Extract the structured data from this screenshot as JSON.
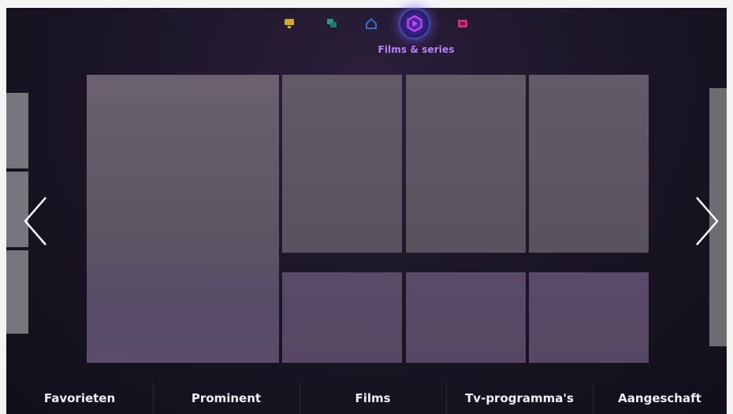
{
  "hub": {
    "title": "Films & series",
    "icons": [
      {
        "name": "on-tv-icon",
        "color": "#d4a72b"
      },
      {
        "name": "social-icon",
        "color": "#2a9c86"
      },
      {
        "name": "apps-icon",
        "color": "#2f6fd0"
      },
      {
        "name": "films-series-icon",
        "color": "#c63bd1",
        "active": true
      },
      {
        "name": "multimedia-icon",
        "color": "#d02f6d"
      }
    ]
  },
  "navigation": {
    "prev": "left-chevron-icon",
    "next": "right-chevron-icon"
  },
  "bottom_nav": {
    "items": [
      {
        "label": "Favorieten"
      },
      {
        "label": "Prominent"
      },
      {
        "label": "Films"
      },
      {
        "label": "Tv-programma's"
      },
      {
        "label": "Aangeschaft"
      }
    ]
  },
  "colors": {
    "accent": "#b482ff",
    "background": "#1a1424",
    "tile": "#5d5563"
  }
}
